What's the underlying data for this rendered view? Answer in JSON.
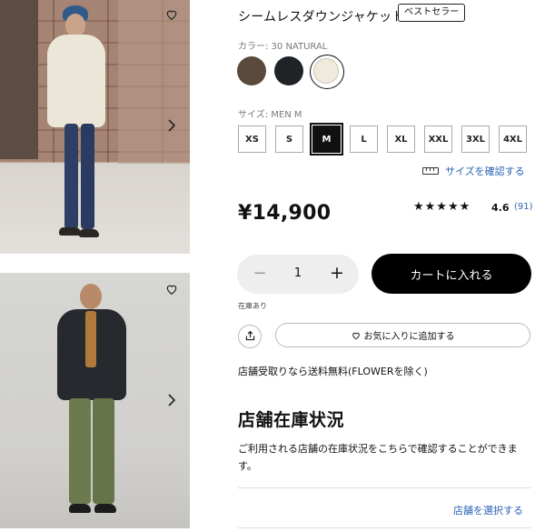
{
  "product": {
    "title": "シームレスダウンジャケット",
    "badge": "ベストセラー",
    "color_label": "カラー: 30 NATURAL",
    "colors": [
      {
        "name": "brown",
        "hex": "#5a4a3c"
      },
      {
        "name": "black",
        "hex": "#1f2226"
      },
      {
        "name": "natural",
        "hex": "#eeeadc",
        "selected": true
      }
    ],
    "size_label": "サイズ: MEN M",
    "sizes": [
      "XS",
      "S",
      "M",
      "L",
      "XL",
      "XXL",
      "3XL",
      "4XL"
    ],
    "selected_size": "M",
    "size_guide_link": "サイズを確認する",
    "price": "¥14,900",
    "stars_display": "★★★★★",
    "rating_value": 4.6,
    "rating": "4.6",
    "review_count": "(91)",
    "quantity": "1",
    "minus": "−",
    "plus": "+",
    "add_to_cart": "カートに入れる",
    "stock_status": "在庫あり",
    "add_to_favorites": "お気に入りに追加する",
    "shipping_note": "店舗受取りなら送料無料(FLOWERを除く)",
    "store_stock_heading": "店舗在庫状況",
    "store_stock_description": "ご利用される店舗の在庫状況をこちらで確認することができます。",
    "select_store_link": "店舗を選択する"
  },
  "colors": {
    "accent_link": "#2b63b5",
    "cart_button": "#000000",
    "stepper_bg": "#eeeeee"
  },
  "icons": [
    "heart-icon",
    "chevron-right-icon",
    "ruler-icon",
    "share-icon",
    "star-icon"
  ]
}
